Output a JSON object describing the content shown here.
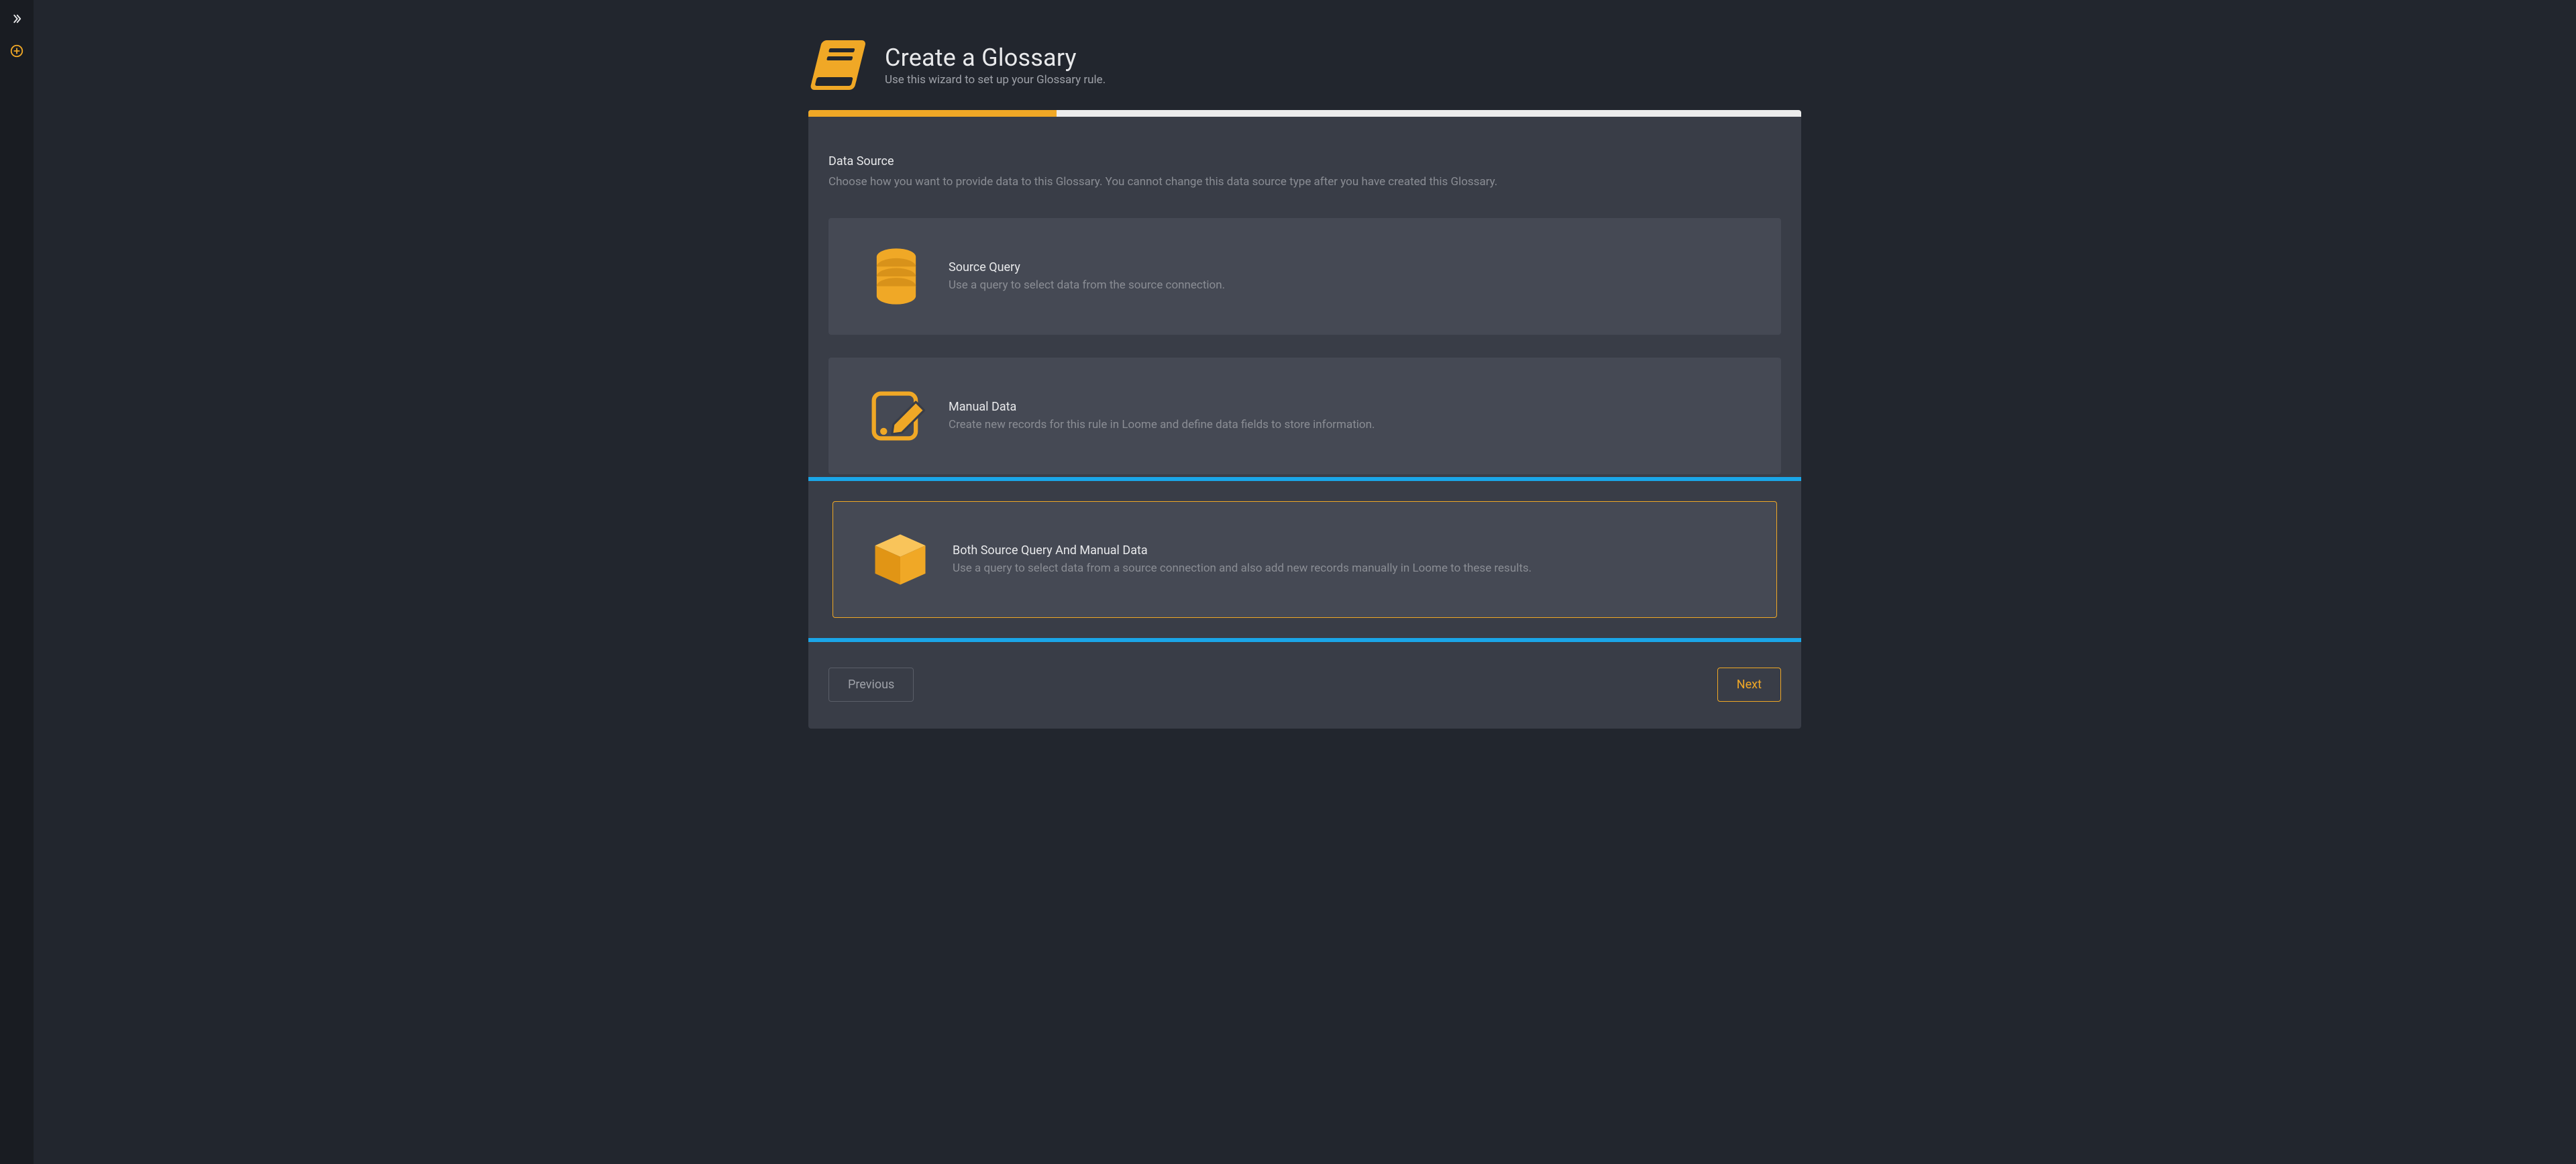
{
  "colors": {
    "accent": "#f0a826",
    "highlight": "#1aa6e8"
  },
  "rail": {
    "expand_icon": "chevron-double-right",
    "add_icon": "plus-circle"
  },
  "header": {
    "title": "Create a Glossary",
    "subtitle": "Use this wizard to set up your Glossary rule.",
    "icon": "book"
  },
  "wizard": {
    "progress_percent": 25,
    "section_title": "Data Source",
    "section_desc": "Choose how you want to provide data to this Glossary. You cannot change this data source type after you have created this Glossary.",
    "options": [
      {
        "id": "source-query",
        "icon": "database",
        "title": "Source Query",
        "desc": "Use a query to select data from the source connection.",
        "selected": false,
        "highlighted": false
      },
      {
        "id": "manual-data",
        "icon": "edit-note",
        "title": "Manual Data",
        "desc": "Create new records for this rule in Loome and define data fields to store information.",
        "selected": false,
        "highlighted": false
      },
      {
        "id": "both",
        "icon": "cube",
        "title": "Both Source Query And Manual Data",
        "desc": "Use a query to select data from a source connection and also add new records manually in Loome to these results.",
        "selected": true,
        "highlighted": true
      }
    ],
    "buttons": {
      "previous": "Previous",
      "next": "Next"
    }
  }
}
